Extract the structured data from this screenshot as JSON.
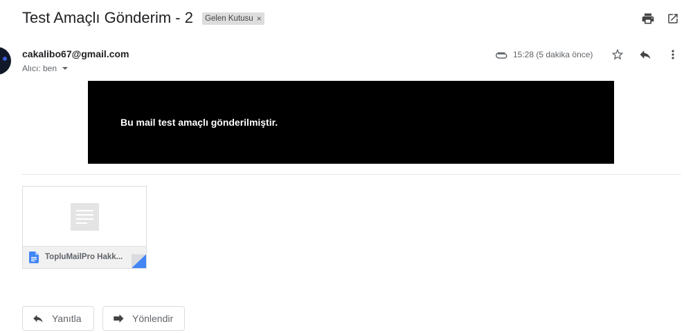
{
  "email": {
    "subject": "Test Amaçlı Gönderim - 2",
    "label": "Gelen Kutusu",
    "label_remove": "×",
    "sender": "cakalibo67@gmail.com",
    "recipient": "Alıcı: ben",
    "timestamp": "15:28 (5 dakika önce)",
    "body_text": "Bu mail test amaçlı gönderilmiştir."
  },
  "attachment": {
    "name": "TopluMailPro Hakk..."
  },
  "actions": {
    "reply": "Yanıtla",
    "forward": "Yönlendir"
  },
  "icons": {
    "top": [
      "printer-icon",
      "open-in-new-window-icon"
    ],
    "header": [
      "attachment-clip-icon",
      "star-icon",
      "reply-icon",
      "more-vert-icon"
    ],
    "file": "google-docs-icon"
  },
  "colors": {
    "banner": "#000000",
    "docs_blue": "#4285f4"
  }
}
